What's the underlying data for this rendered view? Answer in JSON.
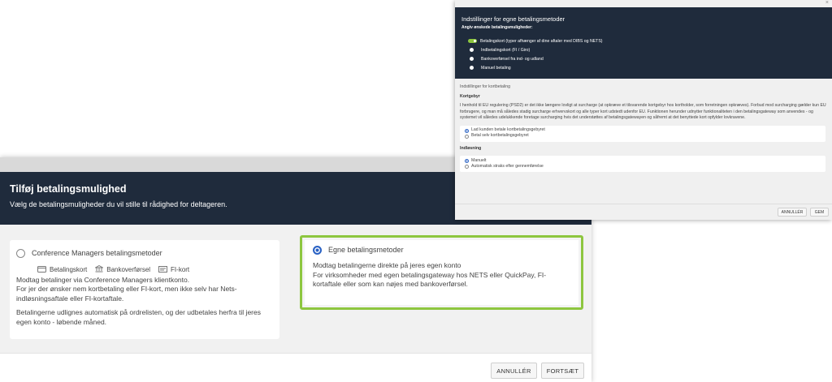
{
  "dialog_add": {
    "title": "Tilføj betalingsmulighed",
    "subtitle": "Vælg de betalingsmuligheder du vil stille til rådighed for deltageren.",
    "option_cm": {
      "title": "Conference Managers betalingsmetoder",
      "methods": [
        {
          "icon": "credit-card-icon",
          "label": "Betalingskort"
        },
        {
          "icon": "bank-icon",
          "label": "Bankoverførsel"
        },
        {
          "icon": "fi-card-icon",
          "label": "FI-kort"
        }
      ],
      "desc1": "Modtag betalinger via Conference Managers klientkonto.",
      "desc2": "For jer der ønsker nem kortbetaling eller FI-kort, men ikke selv har Nets-indløsningsaftale eller FI-kortaftale.",
      "desc3": "Betalingerne udlignes automatisk på ordrelisten, og der udbetales herfra til jeres egen konto - løbende måned."
    },
    "option_own": {
      "title": "Egne betalingsmetoder",
      "desc1": "Modtag betalingerne direkte på jeres egen konto",
      "desc2": "For virksomheder med egen betalingsgateway hos NETS eller QuickPay, FI-kortaftale eller som kan nøjes med bankoverførsel."
    },
    "cancel_label": "ANNULLÉR",
    "continue_label": "FORTSÆT"
  },
  "dialog_settings": {
    "close": "×",
    "title": "Indstillinger for egne betalingsmetoder",
    "prompt": "Angiv ønskede betalingsmuligheder:",
    "options": [
      "Betalingskort (typer afhænger af dine aftaler med DIBS og NETS)",
      "Indbetalingskort (FI / Giro)",
      "Bankoverførsel fra ind- og udland",
      "Manuel betaling"
    ],
    "section_card": "Indstillinger for kortbetaling",
    "fee_heading": "Kortgebyr",
    "fee_text": "I henhold til EU regulering (PSD2) er det ikke længere lovligt at surcharge (at opkræve et tilsvarende kortgebyr hos kortholder, som forretningen opkræves). Forbud mod surcharging gælder kun EU forbrugere, og man må således stadig surcharge erhvervskort og alle typer kort udstedt udenfor EU. Funktionen herunder udnytter funktionaliteten i den betalingsgateway som anvendes - og systemet vil således udelukkende foretage surcharging hvis det understøttes af betalingsgatewayen og såfremt at det benyttede kort opfylder lovkravene.",
    "fee_options": [
      "Lad kunden betale kortbetalingsgebyret",
      "Betal selv kortbetalingsgebyret"
    ],
    "capture_heading": "Indløsning",
    "capture_options": [
      "Manuelt",
      "Automatisk straks efter gennemførelse"
    ],
    "cancel_label": "ANNULLÉR",
    "save_label": "GEM"
  }
}
